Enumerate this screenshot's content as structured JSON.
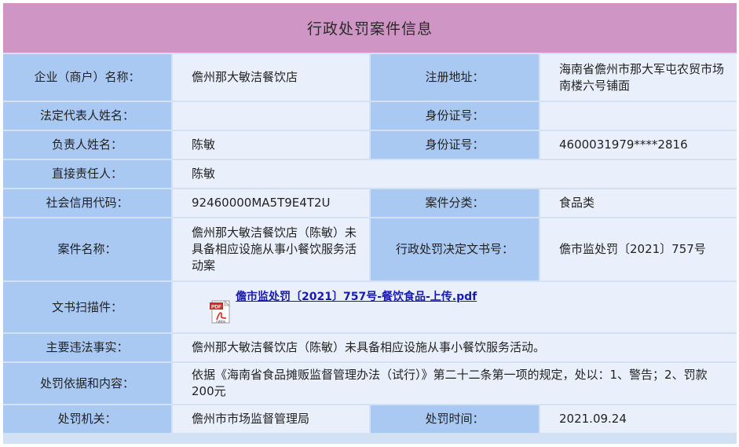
{
  "title": "行政处罚案件信息",
  "rows": {
    "company_label": "企业（商户）名称：",
    "company_value": "儋州那大敏洁餐饮店",
    "address_label": "注册地址：",
    "address_value": "海南省儋州市那大军屯农贸市场南楼六号铺面",
    "legal_rep_label": "法定代表人姓名：",
    "legal_rep_value": "",
    "legal_id_label": "身份证号：",
    "legal_id_value": "",
    "principal_label": "负责人姓名：",
    "principal_value": "陈敏",
    "principal_id_label": "身份证号：",
    "principal_id_value": "4600031979****2816",
    "direct_label": "直接责任人：",
    "direct_value": "陈敏",
    "credit_label": "社会信用代码：",
    "credit_value": "92460000MA5T9E4T2U",
    "category_label": "案件分类：",
    "category_value": "食品类",
    "case_name_label": "案件名称：",
    "case_name_value": "儋州那大敏洁餐饮店（陈敏）未具备相应设施从事小餐饮服务活动案",
    "decision_label": "行政处罚决定文书号：",
    "decision_value": "儋市监处罚〔2021〕757号",
    "scan_label": "文书扫描件：",
    "scan_file": "儋市监处罚〔2021〕757号-餐饮食品-上传.pdf",
    "facts_label": "主要违法事实：",
    "facts_value": "儋州那大敏洁餐饮店（陈敏）未具备相应设施从事小餐饮服务活动。",
    "basis_label": "处罚依据和内容：",
    "basis_value": "依据《海南省食品摊贩监督管理办法（试行）》第二十二条第一项的规定，处以：1、警告；2、罚款200元",
    "authority_label": "处罚机关：",
    "authority_value": "儋州市市场监督管理局",
    "time_label": "处罚时间：",
    "time_value": "2021.09.24"
  },
  "pdf_icon": {
    "name": "pdf-file-icon",
    "badge_text": "PDF",
    "caption": "Adobe",
    "badge_color": "#d9261c"
  },
  "colors": {
    "title_bg": "#cf95c4",
    "label_bg": "#a9c9f2",
    "value_bg": "#e9f0fb",
    "link": "#1a1ab0"
  }
}
